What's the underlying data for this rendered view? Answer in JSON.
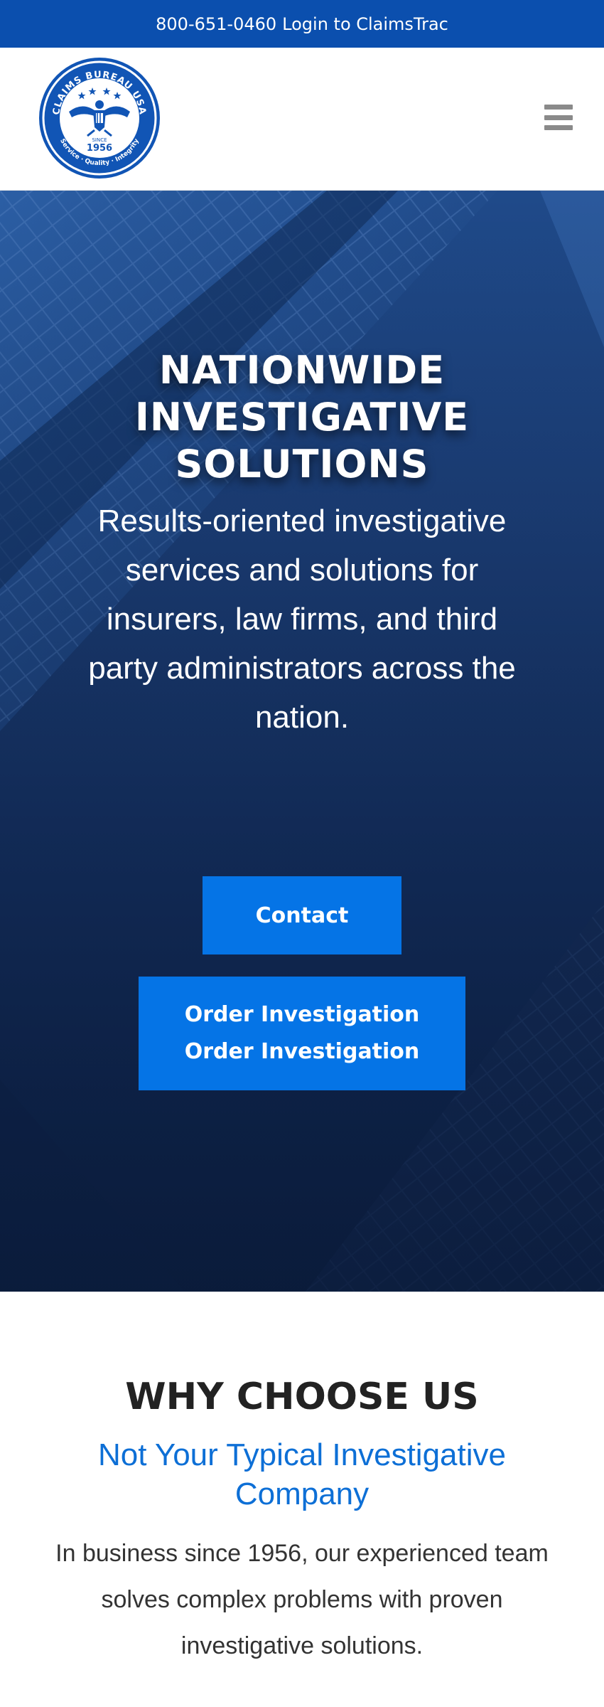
{
  "topbar": {
    "phone": "800-651-0460",
    "login": "Login to ClaimsTrac"
  },
  "header": {
    "logo": {
      "top_text": "CLAIMS BUREAU USA",
      "since_label": "SINCE",
      "since_year": "1956",
      "bottom_text": "Service · Quality · Integrity"
    },
    "menu_icon": "hamburger-icon"
  },
  "hero": {
    "title_lines": [
      "NATIONWIDE",
      "INVESTIGATIVE",
      "SOLUTIONS"
    ],
    "subtitle": "Results-oriented investigative services and solutions for insurers, law firms, and third party administrators across the nation.",
    "contact_label": "Contact",
    "order_label_1": "Order Investigation",
    "order_label_2": "Order Investigation"
  },
  "why": {
    "title": "WHY CHOOSE US",
    "subtitle": "Not Your Typical Investigative Company",
    "body": "In business since 1956, our experienced team solves complex problems with proven investigative solutions."
  },
  "colors": {
    "topbar": "#0b4fae",
    "button": "#0574e6",
    "accent_text": "#0d6fd6",
    "hero_dark": "#0c1f42"
  }
}
